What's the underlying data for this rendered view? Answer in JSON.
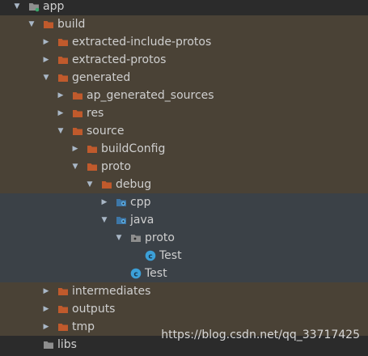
{
  "colors": {
    "background": "#2b2b2b",
    "build_highlight": "#4a4236",
    "generated_highlight": "#3b4147",
    "folder_orange": "#c05a2c",
    "folder_gray": "#8e8e8e",
    "folder_blue": "#3d77a8",
    "class_blue": "#3ca0d8",
    "module_teal": "#3aa66b"
  },
  "tree": {
    "app": {
      "label": "app",
      "icon": "module-folder-icon"
    },
    "build": {
      "label": "build",
      "icon": "excluded-folder-icon"
    },
    "extracted_include_protos": {
      "label": "extracted-include-protos",
      "icon": "excluded-folder-icon"
    },
    "extracted_protos": {
      "label": "extracted-protos",
      "icon": "excluded-folder-icon"
    },
    "generated": {
      "label": "generated",
      "icon": "excluded-folder-icon"
    },
    "ap_generated_sources": {
      "label": "ap_generated_sources",
      "icon": "excluded-folder-icon"
    },
    "res": {
      "label": "res",
      "icon": "excluded-folder-icon"
    },
    "source": {
      "label": "source",
      "icon": "excluded-folder-icon"
    },
    "buildConfig": {
      "label": "buildConfig",
      "icon": "excluded-folder-icon"
    },
    "proto": {
      "label": "proto",
      "icon": "excluded-folder-icon"
    },
    "debug": {
      "label": "debug",
      "icon": "excluded-folder-icon"
    },
    "cpp": {
      "label": "cpp",
      "icon": "generated-source-folder-icon"
    },
    "java": {
      "label": "java",
      "icon": "generated-source-folder-icon"
    },
    "java_proto": {
      "label": "proto",
      "icon": "package-icon"
    },
    "test_inner": {
      "label": "Test",
      "icon": "class-icon"
    },
    "test_outer": {
      "label": "Test",
      "icon": "class-icon"
    },
    "intermediates": {
      "label": "intermediates",
      "icon": "excluded-folder-icon"
    },
    "outputs": {
      "label": "outputs",
      "icon": "excluded-folder-icon"
    },
    "tmp": {
      "label": "tmp",
      "icon": "excluded-folder-icon"
    },
    "libs": {
      "label": "libs",
      "icon": "folder-icon"
    }
  },
  "watermark": "https://blog.csdn.net/qq_33717425"
}
